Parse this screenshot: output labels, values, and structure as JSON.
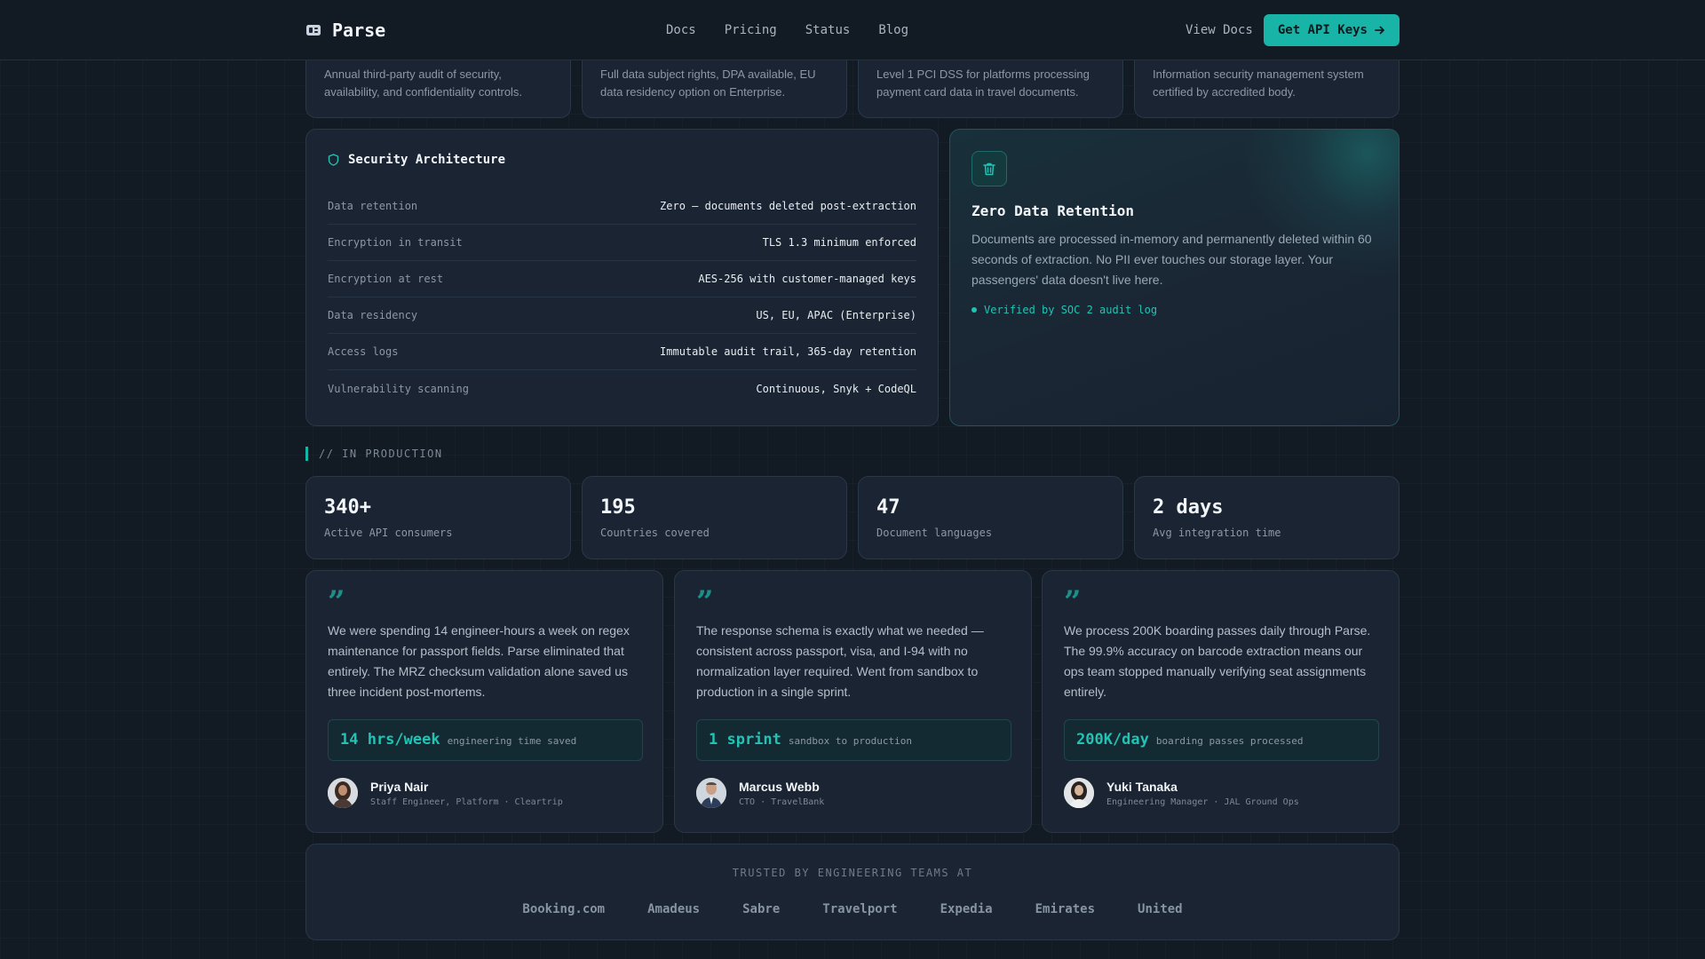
{
  "nav": {
    "brand": "Parse",
    "links": [
      "Docs",
      "Pricing",
      "Status",
      "Blog"
    ],
    "view_docs": "View Docs",
    "cta": "Get API Keys"
  },
  "certs": [
    {
      "desc": "Annual third-party audit of security, availability, and confidentiality controls."
    },
    {
      "desc": "Full data subject rights, DPA available, EU data residency option on Enterprise."
    },
    {
      "desc": "Level 1 PCI DSS for platforms processing payment card data in travel documents."
    },
    {
      "desc": "Information security management system certified by accredited body."
    }
  ],
  "security": {
    "title": "Security Architecture",
    "rows": [
      {
        "k": "Data retention",
        "v": "Zero — documents deleted post-extraction"
      },
      {
        "k": "Encryption in transit",
        "v": "TLS 1.3 minimum enforced"
      },
      {
        "k": "Encryption at rest",
        "v": "AES-256 with customer-managed keys"
      },
      {
        "k": "Data residency",
        "v": "US, EU, APAC (Enterprise)"
      },
      {
        "k": "Access logs",
        "v": "Immutable audit trail, 365-day retention"
      },
      {
        "k": "Vulnerability scanning",
        "v": "Continuous, Snyk + CodeQL"
      }
    ]
  },
  "zdr": {
    "title": "Zero Data Retention",
    "desc": "Documents are processed in-memory and permanently deleted within 60 seconds of extraction. No PII ever touches our storage layer. Your passengers' data doesn't live here.",
    "verified": "Verified by SOC 2 audit log"
  },
  "production": {
    "label": "// IN PRODUCTION",
    "stats": [
      {
        "num": "340+",
        "label": "Active API consumers"
      },
      {
        "num": "195",
        "label": "Countries covered"
      },
      {
        "num": "47",
        "label": "Document languages"
      },
      {
        "num": "2 days",
        "label": "Avg integration time"
      }
    ]
  },
  "testimonials": [
    {
      "quote": "We were spending 14 engineer-hours a week on regex maintenance for passport fields. Parse eliminated that entirely. The MRZ checksum validation alone saved us three incident post-mortems.",
      "metric": "14 hrs/week",
      "metric_label": "engineering time saved",
      "name": "Priya Nair",
      "role": "Staff Engineer, Platform · Cleartrip"
    },
    {
      "quote": "The response schema is exactly what we needed — consistent across passport, visa, and I-94 with no normalization layer required. Went from sandbox to production in a single sprint.",
      "metric": "1 sprint",
      "metric_label": "sandbox to production",
      "name": "Marcus Webb",
      "role": "CTO · TravelBank"
    },
    {
      "quote": "We process 200K boarding passes daily through Parse. The 99.9% accuracy on barcode extraction means our ops team stopped manually verifying seat assignments entirely.",
      "metric": "200K/day",
      "metric_label": "boarding passes processed",
      "name": "Yuki Tanaka",
      "role": "Engineering Manager · JAL Ground Ops"
    }
  ],
  "trusted": {
    "title": "TRUSTED BY ENGINEERING TEAMS AT",
    "logos": [
      "Booking.com",
      "Amadeus",
      "Sabre",
      "Travelport",
      "Expedia",
      "Emirates",
      "United"
    ]
  },
  "colors": {
    "accent": "#19b4a8",
    "bg": "#121a24",
    "card": "#1a2432"
  }
}
